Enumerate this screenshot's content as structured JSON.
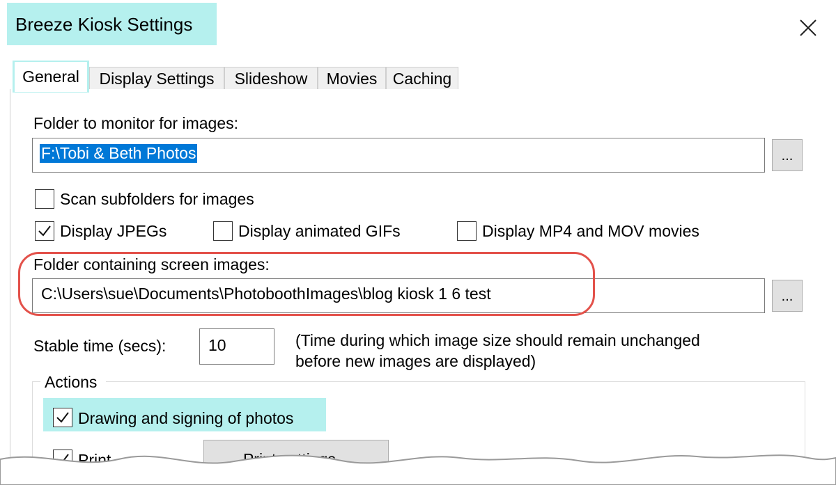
{
  "window": {
    "title": "Breeze Kiosk Settings",
    "close_glyph": "×"
  },
  "tabs": [
    {
      "label": "General",
      "active": true
    },
    {
      "label": "Display Settings",
      "active": false
    },
    {
      "label": "Slideshow",
      "active": false
    },
    {
      "label": "Movies",
      "active": false
    },
    {
      "label": "Caching",
      "active": false
    }
  ],
  "general": {
    "monitor_folder_label": "Folder to monitor for images:",
    "monitor_folder_value": "F:\\Tobi & Beth Photos",
    "browse_label": "...",
    "scan_subfolders_label": "Scan subfolders for images",
    "scan_subfolders_checked": false,
    "display_jpegs_label": "Display JPEGs",
    "display_jpegs_checked": true,
    "display_gifs_label": "Display animated GIFs",
    "display_gifs_checked": false,
    "display_movies_label": "Display MP4 and MOV movies",
    "display_movies_checked": false,
    "screen_images_label": "Folder containing screen images:",
    "screen_images_value": "C:\\Users\\sue\\Documents\\PhotoboothImages\\blog kiosk 1 6 test",
    "stable_time_label": "Stable time (secs):",
    "stable_time_value": "10",
    "stable_time_note_line1": "(Time during which image size should remain unchanged",
    "stable_time_note_line2": "before new  images are displayed)"
  },
  "actions": {
    "group_label": "Actions",
    "drawing_label": "Drawing and signing of photos",
    "drawing_checked": true,
    "print_label": "Print",
    "print_settings_label": "Print settings..."
  },
  "colors": {
    "highlight": "#b5f0ee",
    "callout": "#e3514a",
    "selection": "#0078d7"
  }
}
